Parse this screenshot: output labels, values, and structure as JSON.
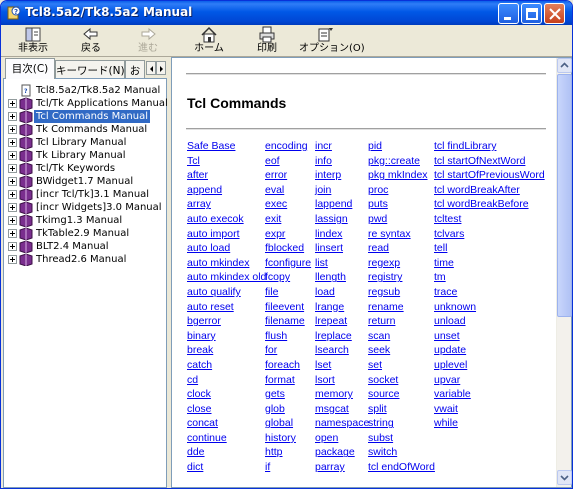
{
  "window": {
    "title": "Tcl8.5a2/Tk8.5a2 Manual",
    "accent": "#0058e6"
  },
  "toolbar": {
    "hide": "非表示",
    "back": "戻る",
    "forward": "進む",
    "home": "ホーム",
    "print": "印刷",
    "options": "オプション(O)"
  },
  "tabs": {
    "contents": "目次(C)",
    "index": "キーワード(N)",
    "favorites": "お"
  },
  "tree": {
    "items": [
      {
        "label": "Tcl8.5a2/Tk8.5a2 Manual",
        "icon": "page-icon",
        "expandable": false
      },
      {
        "label": "Tcl/Tk Applications Manual",
        "icon": "book-icon",
        "expandable": true
      },
      {
        "label": "Tcl Commands Manual",
        "icon": "book-icon",
        "expandable": true
      },
      {
        "label": "Tk Commands Manual",
        "icon": "book-icon",
        "expandable": true
      },
      {
        "label": "Tcl Library Manual",
        "icon": "book-icon",
        "expandable": true
      },
      {
        "label": "Tk Library Manual",
        "icon": "book-icon",
        "expandable": true
      },
      {
        "label": "Tcl/Tk Keywords",
        "icon": "book-icon",
        "expandable": true
      },
      {
        "label": "BWidget1.7 Manual",
        "icon": "book-icon",
        "expandable": true
      },
      {
        "label": "[incr Tcl/Tk]3.1 Manual",
        "icon": "book-icon",
        "expandable": true
      },
      {
        "label": "[incr Widgets]3.0 Manual",
        "icon": "book-icon",
        "expandable": true
      },
      {
        "label": "Tkimg1.3 Manual",
        "icon": "book-icon",
        "expandable": true
      },
      {
        "label": "TkTable2.9 Manual",
        "icon": "book-icon",
        "expandable": true
      },
      {
        "label": "BLT2.4 Manual",
        "icon": "book-icon",
        "expandable": true
      },
      {
        "label": "Thread2.6 Manual",
        "icon": "book-icon",
        "expandable": true
      }
    ],
    "selected_label": "Tcl Commands Manual"
  },
  "page": {
    "title": "Tcl Commands",
    "link_color": "#0000ee",
    "columns": [
      [
        "Safe Base",
        "Tcl",
        "after",
        "append",
        "array",
        "auto execok",
        "auto import",
        "auto load",
        "auto mkindex",
        "auto mkindex old",
        "auto qualify",
        "auto reset",
        "bgerror",
        "binary",
        "break",
        "catch",
        "cd",
        "clock",
        "close",
        "concat",
        "continue",
        "dde",
        "dict"
      ],
      [
        "encoding",
        "eof",
        "error",
        "eval",
        "exec",
        "exit",
        "expr",
        "fblocked",
        "fconfigure",
        "fcopy",
        "file",
        "fileevent",
        "filename",
        "flush",
        "for",
        "foreach",
        "format",
        "gets",
        "glob",
        "global",
        "history",
        "http",
        "if"
      ],
      [
        "incr",
        "info",
        "interp",
        "join",
        "lappend",
        "lassign",
        "lindex",
        "linsert",
        "list",
        "llength",
        "load",
        "lrange",
        "lrepeat",
        "lreplace",
        "lsearch",
        "lset",
        "lsort",
        "memory",
        "msgcat",
        "namespace",
        "open",
        "package",
        "parray"
      ],
      [
        "pid",
        "pkg::create",
        "pkg mkIndex",
        "proc",
        "puts",
        "pwd",
        "re syntax",
        "read",
        "regexp",
        "registry",
        "regsub",
        "rename",
        "return",
        "scan",
        "seek",
        "set",
        "socket",
        "source",
        "split",
        "string",
        "subst",
        "switch",
        "tcl endOfWord"
      ],
      [
        "tcl findLibrary",
        "tcl startOfNextWord",
        "tcl startOfPreviousWord",
        "tcl wordBreakAfter",
        "tcl wordBreakBefore",
        "tcltest",
        "tclvars",
        "tell",
        "time",
        "tm",
        "trace",
        "unknown",
        "unload",
        "unset",
        "update",
        "uplevel",
        "upvar",
        "variable",
        "vwait",
        "while"
      ]
    ]
  }
}
